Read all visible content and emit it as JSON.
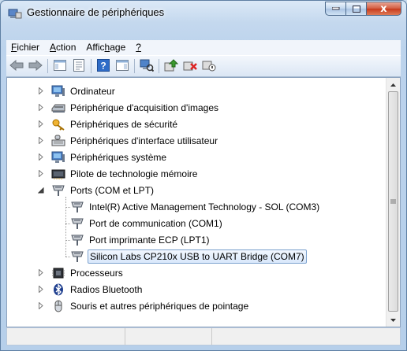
{
  "window": {
    "title": "Gestionnaire de périphériques"
  },
  "window_controls": {
    "close_glyph": "x"
  },
  "menu": [
    {
      "label": "Fichier",
      "accel_index": 0
    },
    {
      "label": "Action",
      "accel_index": 0
    },
    {
      "label": "Affichage",
      "accel_index": 5
    },
    {
      "label": "?",
      "accel_index": 0
    }
  ],
  "toolbar": {
    "buttons": [
      "back-arrow-icon",
      "forward-arrow-icon",
      "sep",
      "show-hide-console-tree-icon",
      "properties-icon",
      "sep",
      "help-icon",
      "action-pane-icon",
      "sep",
      "scan-hardware-icon",
      "sep",
      "update-driver-icon",
      "uninstall-icon",
      "disable-device-icon"
    ]
  },
  "tree": {
    "items": [
      {
        "label": "Ordinateur",
        "level": 1,
        "expander": "collapsed",
        "icon": "computer-icon"
      },
      {
        "label": "Périphérique d'acquisition d'images",
        "level": 1,
        "expander": "collapsed",
        "icon": "scanner-icon"
      },
      {
        "label": "Périphériques de sécurité",
        "level": 1,
        "expander": "collapsed",
        "icon": "key-icon"
      },
      {
        "label": "Périphériques d'interface utilisateur",
        "level": 1,
        "expander": "collapsed",
        "icon": "hid-icon"
      },
      {
        "label": "Périphériques système",
        "level": 1,
        "expander": "collapsed",
        "icon": "computer-icon"
      },
      {
        "label": "Pilote de technologie mémoire",
        "level": 1,
        "expander": "collapsed",
        "icon": "memory-icon"
      },
      {
        "label": "Ports (COM et LPT)",
        "level": 1,
        "expander": "expanded",
        "icon": "port-icon"
      },
      {
        "label": "Intel(R) Active Management Technology - SOL (COM3)",
        "level": 2,
        "expander": "none",
        "icon": "port-icon"
      },
      {
        "label": "Port de communication (COM1)",
        "level": 2,
        "expander": "none",
        "icon": "port-icon"
      },
      {
        "label": "Port imprimante ECP (LPT1)",
        "level": 2,
        "expander": "none",
        "icon": "port-icon"
      },
      {
        "label": "Silicon Labs CP210x USB to UART Bridge (COM7)",
        "level": 2,
        "expander": "none",
        "icon": "port-icon",
        "selected": true
      },
      {
        "label": "Processeurs",
        "level": 1,
        "expander": "collapsed",
        "icon": "processor-icon"
      },
      {
        "label": "Radios Bluetooth",
        "level": 1,
        "expander": "collapsed",
        "icon": "bluetooth-icon"
      },
      {
        "label": "Souris et autres périphériques de pointage",
        "level": 1,
        "expander": "collapsed",
        "icon": "mouse-icon"
      }
    ]
  },
  "colors": {
    "selection": "#d9e8fb",
    "selection_border": "#7da2ce",
    "frame": "#bcd3ec"
  }
}
